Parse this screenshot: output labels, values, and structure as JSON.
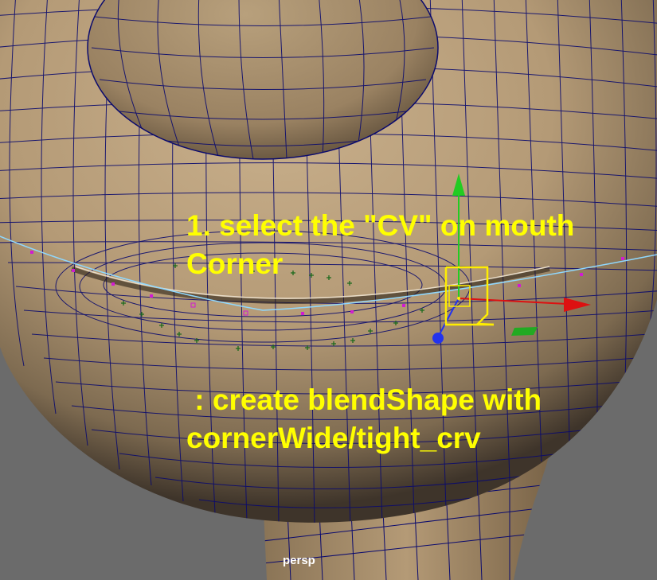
{
  "viewport": {
    "camera_label": "persp"
  },
  "annotations": {
    "step_1_line_1": "1. select the \"CV\" on mouth",
    "step_1_line_2": "Corner",
    "step_2_line_1": " : create blendShape with",
    "step_2_line_2": "cornerWide/tight_crv"
  },
  "colors": {
    "background": "#6b6b6b",
    "surface": "#b39a76",
    "wireframe": "#0a0a6e",
    "annotation": "#ffff00",
    "curve": "#8fd8ff",
    "cv_point": "#d21ad2",
    "manip_y": "#22cc22",
    "manip_x": "#dd1111",
    "manip_z": "#2233ee",
    "selection_box": "#ffee00"
  },
  "icons": [
    "move-manipulator-icon",
    "cv-selection-box-icon"
  ]
}
